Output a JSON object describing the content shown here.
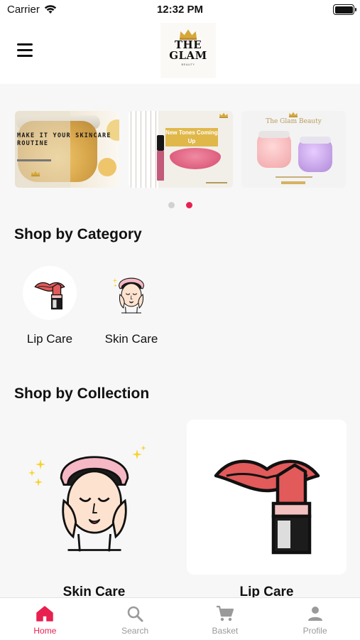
{
  "status_bar": {
    "carrier": "Carrier",
    "time": "12:32 PM"
  },
  "header": {
    "logo": {
      "line1": "THE",
      "line2": "GLAM",
      "tagline": "BEAUTY"
    }
  },
  "banners": [
    {
      "text": "MAKE IT YOUR SKINCARE ROUTINE"
    },
    {
      "tag": "New Tones Coming Up"
    },
    {
      "title": "The Glam Beauty"
    }
  ],
  "pager": {
    "count": 2,
    "active_index": 1
  },
  "category_section": {
    "title": "Shop by Category",
    "items": [
      {
        "label": "Lip Care",
        "icon": "lipstick-icon"
      },
      {
        "label": "Skin Care",
        "icon": "face-mask-icon"
      }
    ]
  },
  "collection_section": {
    "title": "Shop by Collection",
    "items": [
      {
        "label": "Skin Care",
        "icon": "skin-care-illustration"
      },
      {
        "label": "Lip Care",
        "icon": "lip-care-illustration"
      }
    ]
  },
  "tab_bar": {
    "tabs": [
      {
        "label": "Home",
        "icon": "home-icon",
        "active": true
      },
      {
        "label": "Search",
        "icon": "search-icon",
        "active": false
      },
      {
        "label": "Basket",
        "icon": "cart-icon",
        "active": false
      },
      {
        "label": "Profile",
        "icon": "person-icon",
        "active": false
      }
    ]
  },
  "colors": {
    "accent": "#e8204f",
    "inactive": "#9a9a9a",
    "background": "#f7f7f7"
  }
}
